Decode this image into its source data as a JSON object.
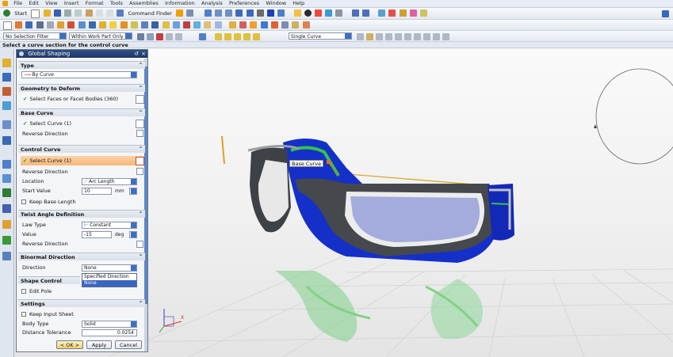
{
  "menu": {
    "items": [
      "File",
      "Edit",
      "View",
      "Insert",
      "Format",
      "Tools",
      "Assemblies",
      "Information",
      "Analysis",
      "Preferences",
      "Window",
      "Help"
    ]
  },
  "toolbar": {
    "start_label": "Start",
    "command_finder_label": "Command Finder",
    "selection_filter": "No Selection Filter",
    "scope": "Within Work Part Only",
    "curve_rule": "Single Curve"
  },
  "cue_line": "Select a curve section for the control curve",
  "dialog": {
    "title": "Global Shaping",
    "type": {
      "header": "Type",
      "value": "By Curve"
    },
    "geometry": {
      "header": "Geometry to Deform",
      "select": "Select Faces or Facet Bodies (360)"
    },
    "base_curve": {
      "header": "Base Curve",
      "select": "Select Curve (1)",
      "reverse": "Reverse Direction"
    },
    "control_curve": {
      "header": "Control Curve",
      "select": "Select Curve (1)",
      "reverse": "Reverse Direction",
      "location_label": "Location",
      "location_value": "Arc Length",
      "start_label": "Start Value",
      "start_value": "10",
      "start_unit": "mm",
      "keep_base": "Keep Base Length"
    },
    "twist": {
      "header": "Twist Angle Definition",
      "law_label": "Law Type",
      "law_value": "Constant",
      "value_label": "Value",
      "value": "-15",
      "unit": "deg",
      "reverse": "Reverse Direction"
    },
    "binormal": {
      "header": "Binormal Direction",
      "direction_label": "Direction",
      "direction_value": "None",
      "options": [
        "Specified Direction",
        "None"
      ]
    },
    "shape_control": {
      "header": "Shape Control",
      "edit_pole": "Edit Pole"
    },
    "settings": {
      "header": "Settings",
      "keep_input": "Keep Input Sheet",
      "body_type_label": "Body Type",
      "body_type_value": "Solid",
      "tolerance_label": "Distance Tolerance",
      "tolerance_value": "0.0254"
    },
    "buttons": {
      "ok": "< OK >",
      "apply": "Apply",
      "cancel": "Cancel"
    }
  },
  "viewport": {
    "tooltip": "Base Curve",
    "triad_label": "X"
  },
  "colors": {
    "title_bar": "#1d3566",
    "control_curve_highlight": "#f5b77a",
    "model_grey": "#3e4145",
    "model_blue": "#1530c8",
    "model_green": "#2fbf3a"
  }
}
